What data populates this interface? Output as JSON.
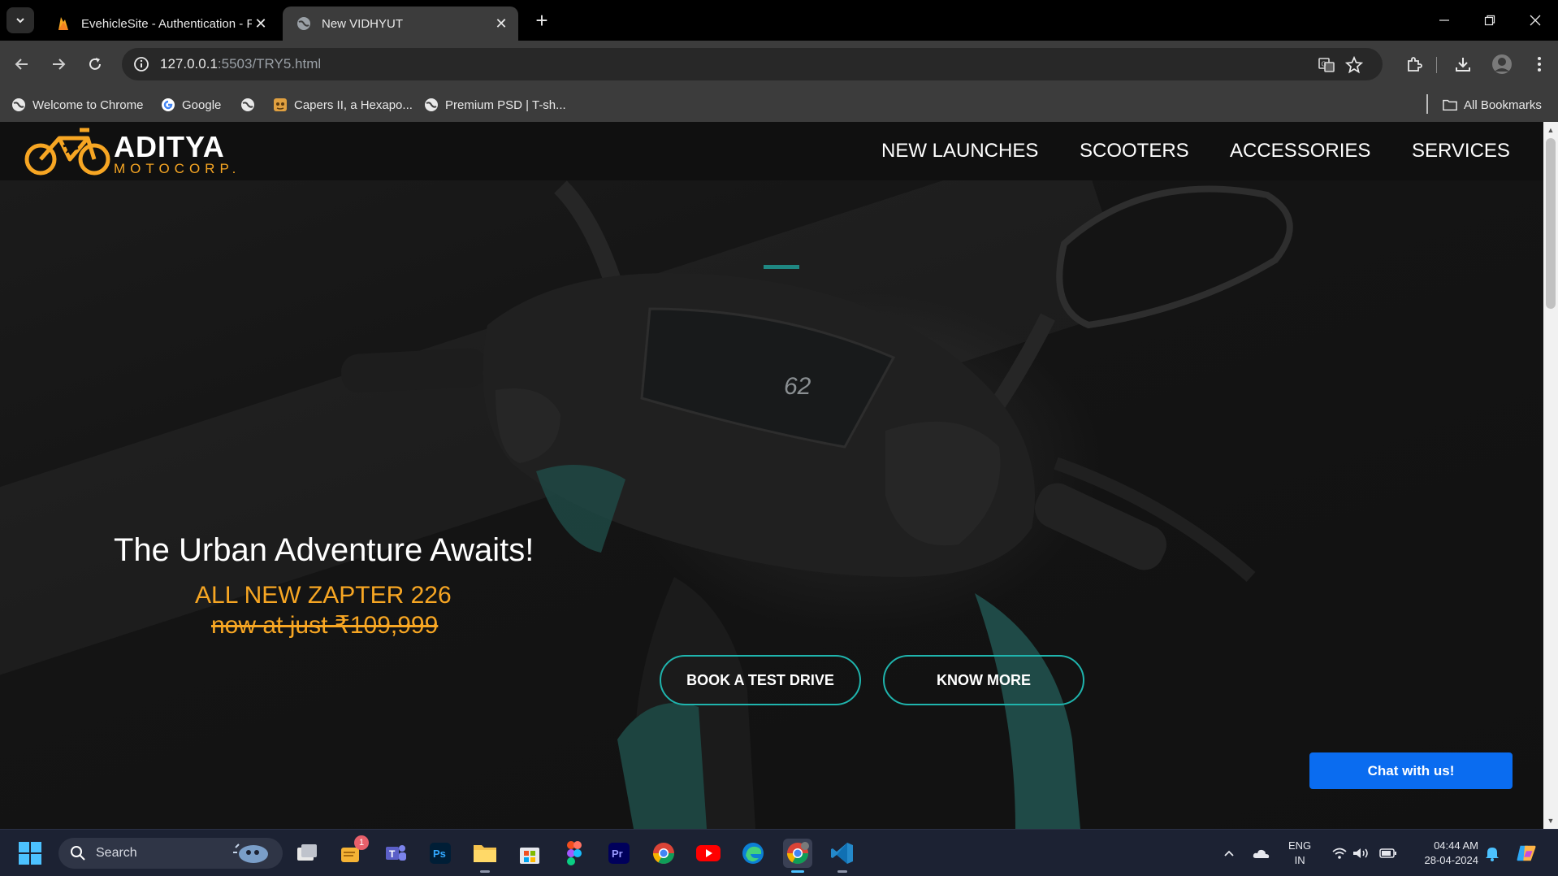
{
  "browser": {
    "tabs": [
      {
        "title": "EvehicleSite - Authentication - F",
        "active": false
      },
      {
        "title": "New VIDHYUT",
        "active": true
      }
    ],
    "address": {
      "host": "127.0.0.1",
      "path": ":5503/TRY5.html"
    },
    "bookmarks": [
      {
        "label": "Welcome to Chrome",
        "icon": "globe-icon"
      },
      {
        "label": "Google",
        "icon": "google-icon"
      },
      {
        "label": "",
        "icon": "globe-icon"
      },
      {
        "label": "Capers II, a Hexapo...",
        "icon": "capers-icon"
      },
      {
        "label": "Premium PSD | T-sh...",
        "icon": "globe-icon"
      }
    ],
    "all_bookmarks_label": "All Bookmarks"
  },
  "site": {
    "logo": {
      "main": "ADITYA",
      "sub": "MOTOCORP."
    },
    "nav": [
      "NEW LAUNCHES",
      "SCOOTERS",
      "ACCESSORIES",
      "SERVICES"
    ],
    "hero": {
      "title": "The Urban Adventure Awaits!",
      "subtitle": "ALL NEW ZAPTER 226",
      "price": "now at just ₹109,999"
    },
    "buttons": {
      "test_drive": "BOOK A TEST DRIVE",
      "know_more": "KNOW MORE"
    },
    "chat": "Chat with us!",
    "colors": {
      "accent": "#f7a623",
      "cta_border": "#1fb4ad",
      "chat_button": "#0a6cf0"
    }
  },
  "taskbar": {
    "search_placeholder": "Search",
    "apps": [
      "file-explorer-icon",
      "task-view-icon",
      "notes-icon",
      "teams-icon",
      "photoshop-icon",
      "folder-icon",
      "store-icon",
      "figma-icon",
      "premiere-icon",
      "chrome-icon",
      "youtube-icon",
      "edge-icon",
      "chrome-active-icon",
      "vscode-icon"
    ],
    "notification_badge": "1",
    "lang": {
      "line1": "ENG",
      "line2": "IN"
    },
    "clock": {
      "time": "04:44 AM",
      "date": "28-04-2024"
    }
  }
}
